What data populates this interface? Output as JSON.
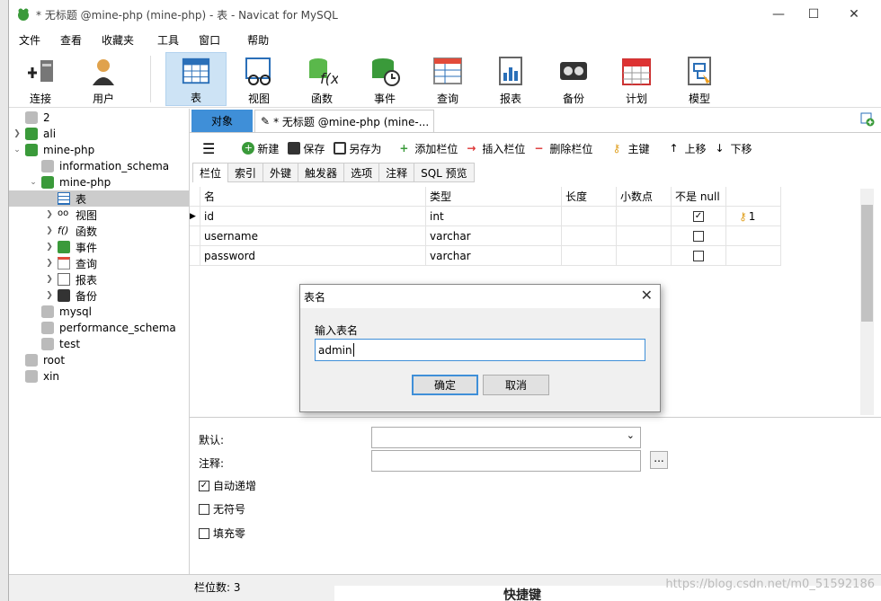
{
  "window": {
    "title": "* 无标题 @mine-php (mine-php) - 表 - Navicat for MySQL"
  },
  "menu": [
    "文件",
    "查看",
    "收藏夹",
    "工具",
    "窗口",
    "帮助"
  ],
  "toolbar": [
    "连接",
    "用户",
    "表",
    "视图",
    "函数",
    "事件",
    "查询",
    "报表",
    "备份",
    "计划",
    "模型"
  ],
  "sidebar": {
    "items": [
      {
        "label": "2",
        "icon": "server-icon"
      },
      {
        "label": "ali",
        "icon": "server-icon"
      },
      {
        "label": "mine-php",
        "icon": "server-icon"
      },
      {
        "label": "information_schema",
        "icon": "database-icon"
      },
      {
        "label": "mine-php",
        "icon": "database-icon"
      },
      {
        "label": "表",
        "icon": "table-icon"
      },
      {
        "label": "视图",
        "icon": "view-icon"
      },
      {
        "label": "函数",
        "icon": "function-icon"
      },
      {
        "label": "事件",
        "icon": "event-icon"
      },
      {
        "label": "查询",
        "icon": "query-icon"
      },
      {
        "label": "报表",
        "icon": "report-icon"
      },
      {
        "label": "备份",
        "icon": "backup-icon"
      },
      {
        "label": "mysql",
        "icon": "database-icon"
      },
      {
        "label": "performance_schema",
        "icon": "database-icon"
      },
      {
        "label": "test",
        "icon": "database-icon"
      },
      {
        "label": "root",
        "icon": "server-icon"
      },
      {
        "label": "xin",
        "icon": "server-icon"
      }
    ]
  },
  "tabs": {
    "objects": "对象",
    "untitled": "* 无标题 @mine-php (mine-..."
  },
  "objtoolbar": [
    "新建",
    "保存",
    "另存为",
    "添加栏位",
    "插入栏位",
    "删除栏位",
    "主键",
    "上移",
    "下移"
  ],
  "subtabs": [
    "栏位",
    "索引",
    "外键",
    "触发器",
    "选项",
    "注释",
    "SQL 预览"
  ],
  "grid": {
    "headers": [
      "名",
      "类型",
      "长度",
      "小数点",
      "不是 null",
      ""
    ],
    "rows": [
      {
        "name": "id",
        "type": "int",
        "notnull": true,
        "key": "1"
      },
      {
        "name": "username",
        "type": "varchar",
        "notnull": false,
        "key": ""
      },
      {
        "name": "password",
        "type": "varchar",
        "notnull": false,
        "key": ""
      }
    ]
  },
  "props": {
    "default_label": "默认:",
    "comment_label": "注释:",
    "auto_inc": "自动递增",
    "unsigned": "无符号",
    "zerofill": "填充零",
    "ellipsis": "..."
  },
  "dialog": {
    "title": "表名",
    "prompt": "输入表名",
    "value": "admin",
    "ok": "确定",
    "cancel": "取消"
  },
  "status": {
    "fields": "栏位数: 3",
    "watermark": "https://blog.csdn.net/m0_51592186",
    "behind": "快捷键"
  }
}
